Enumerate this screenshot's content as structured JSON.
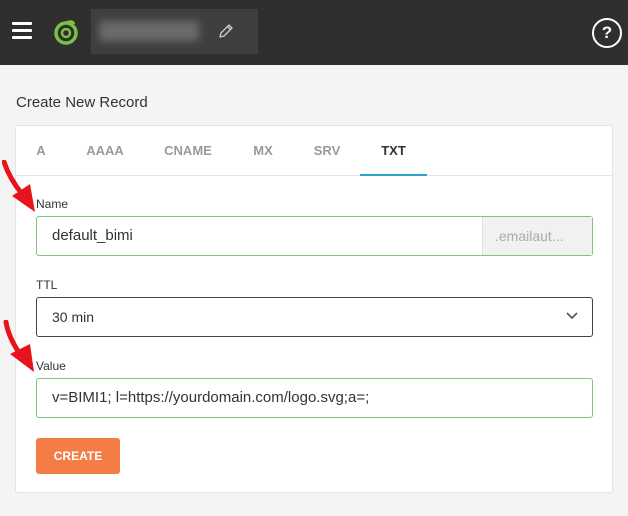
{
  "header": {
    "menu_icon": "hamburger-icon",
    "logo_icon": "app-logo-icon",
    "edit_icon": "pencil-icon",
    "help_label": "?"
  },
  "page": {
    "title": "Create New Record"
  },
  "tabs": [
    {
      "label": "A"
    },
    {
      "label": "AAAA"
    },
    {
      "label": "CNAME"
    },
    {
      "label": "MX"
    },
    {
      "label": "SRV"
    },
    {
      "label": "TXT",
      "active": true
    }
  ],
  "form": {
    "name_label": "Name",
    "name_value": "default_bimi",
    "name_suffix": ".emailaut...",
    "ttl_label": "TTL",
    "ttl_value": "30 min",
    "value_label": "Value",
    "value_value": "v=BIMI1; l=https://yourdomain.com/logo.svg;a=;",
    "create_label": "CREATE"
  },
  "colors": {
    "header_bg": "#2f2f2f",
    "logo_green": "#7cc242",
    "tab_active_underline": "#2fa3d0",
    "field_border_valid": "#7fc57f",
    "create_button": "#f47c45",
    "annotation_arrow": "#e8141b"
  }
}
